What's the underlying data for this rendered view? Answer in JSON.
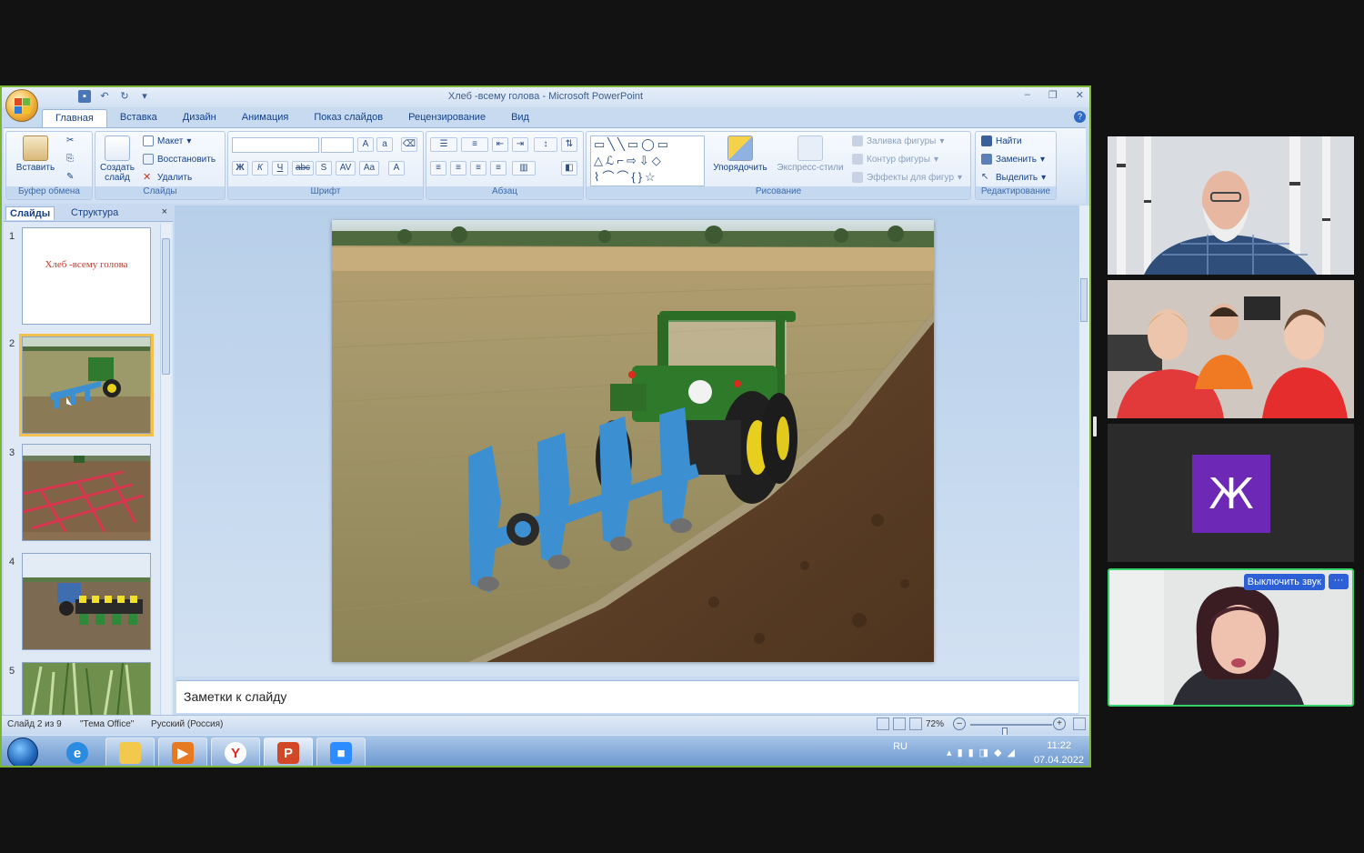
{
  "powerpoint": {
    "title": "Хлеб -всему голова - Microsoft PowerPoint",
    "tabs": [
      "Главная",
      "Вставка",
      "Дизайн",
      "Анимация",
      "Показ слайдов",
      "Рецензирование",
      "Вид"
    ],
    "active_tab": "Главная",
    "ribbon": {
      "clipboard": {
        "label": "Буфер обмена",
        "paste": "Вставить"
      },
      "slides": {
        "label": "Слайды",
        "new_slide": "Создать слайд",
        "layout": "Макет",
        "reset": "Восстановить",
        "delete": "Удалить"
      },
      "font": {
        "label": "Шрифт",
        "buttons": [
          "Ж",
          "К",
          "Ч",
          "abc",
          "S",
          "AV",
          "Aa",
          "A"
        ]
      },
      "paragraph": {
        "label": "Абзац"
      },
      "drawing": {
        "label": "Рисование",
        "arrange": "Упорядочить",
        "quick_styles": "Экспресс-стили",
        "shape_fill": "Заливка фигуры",
        "shape_outline": "Контур фигуры",
        "shape_effects": "Эффекты для фигур"
      },
      "editing": {
        "label": "Редактирование",
        "find": "Найти",
        "replace": "Заменить",
        "select": "Выделить"
      }
    },
    "pane_tabs": {
      "slides": "Слайды",
      "outline": "Структура",
      "close": "×"
    },
    "thumbnails": [
      {
        "number": "1",
        "text": "Хлеб -всему голова"
      },
      {
        "number": "2"
      },
      {
        "number": "3"
      },
      {
        "number": "4"
      },
      {
        "number": "5"
      }
    ],
    "notes_placeholder": "Заметки к слайду",
    "status": {
      "slide": "Слайд 2 из 9",
      "theme": "\"Тема Office\"",
      "language": "Русский (Россия)",
      "zoom": "72%",
      "zoom_fraction": 0.42
    },
    "taskbar": {
      "apps": [
        "start-button",
        "internet-explorer",
        "file-explorer",
        "media-player",
        "yandex-browser",
        "powerpoint",
        "zoom"
      ],
      "language": "RU",
      "time": "11:22",
      "date": "07.04.2022"
    }
  },
  "conference": {
    "participant_initial": "Ж",
    "unmute_label": "Выключить звук",
    "more_label": "···"
  },
  "colors": {
    "window_border": "#7ab536",
    "ribbon": "#dbe7f6",
    "avatar": "#6d28b6",
    "active_speaker": "#36d36b",
    "unmute_button": "#2d5fd6"
  }
}
